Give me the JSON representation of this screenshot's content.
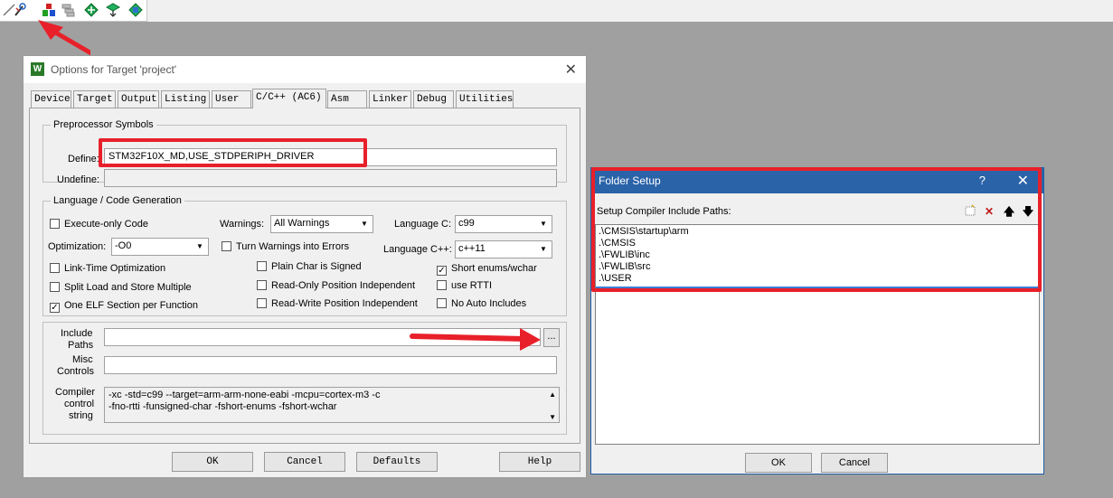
{
  "options_dialog": {
    "title": "Options for Target 'project'",
    "close_glyph": "✕",
    "tabs": [
      "Device",
      "Target",
      "Output",
      "Listing",
      "User",
      "C/C++ (AC6)",
      "Asm",
      "Linker",
      "Debug",
      "Utilities"
    ],
    "active_tab": "C/C++ (AC6)",
    "preprocessor": {
      "legend": "Preprocessor Symbols",
      "define_label": "Define:",
      "define_value": "STM32F10X_MD,USE_STDPERIPH_DRIVER",
      "undefine_label": "Undefine:",
      "undefine_value": ""
    },
    "language": {
      "legend": "Language / Code Generation",
      "execute_only": "Execute-only Code",
      "warnings_label": "Warnings:",
      "warnings_value": "All Warnings",
      "language_c_label": "Language C:",
      "language_c_value": "c99",
      "optimization_label": "Optimization:",
      "optimization_value": "-O0",
      "turn_warnings": "Turn Warnings into Errors",
      "language_cpp_label": "Language C++:",
      "language_cpp_value": "c++11",
      "lto": "Link-Time Optimization",
      "plain_char": "Plain Char is Signed",
      "short_enums": "Short enums/wchar",
      "split_load": "Split Load and Store Multiple",
      "ro_pi": "Read-Only Position Independent",
      "use_rtti": "use RTTI",
      "one_elf": "One ELF Section per Function",
      "rw_pi": "Read-Write Position Independent",
      "no_auto": "No Auto Includes"
    },
    "include_label_1": "Include",
    "include_label_2": "Paths",
    "include_value": "",
    "browse_label": "...",
    "misc_label_1": "Misc",
    "misc_label_2": "Controls",
    "misc_value": "",
    "compiler_label_1": "Compiler",
    "compiler_label_2": "control",
    "compiler_label_3": "string",
    "compiler_line_1": "-xc -std=c99 --target=arm-arm-none-eabi -mcpu=cortex-m3 -c",
    "compiler_line_2": "-fno-rtti -funsigned-char -fshort-enums -fshort-wchar",
    "buttons": {
      "ok": "OK",
      "cancel": "Cancel",
      "defaults": "Defaults",
      "help": "Help"
    }
  },
  "folder_setup": {
    "title": "Folder Setup",
    "help_glyph": "?",
    "close_glyph": "✕",
    "list_label": "Setup Compiler Include Paths:",
    "paths": [
      ".\\CMSIS\\startup\\arm",
      ".\\CMSIS",
      ".\\FWLIB\\inc",
      ".\\FWLIB\\src",
      ".\\USER"
    ],
    "ok": "OK",
    "cancel": "Cancel"
  },
  "colors": {
    "highlight": "#e8202a",
    "folder_titlebar": "#2b63a8"
  }
}
